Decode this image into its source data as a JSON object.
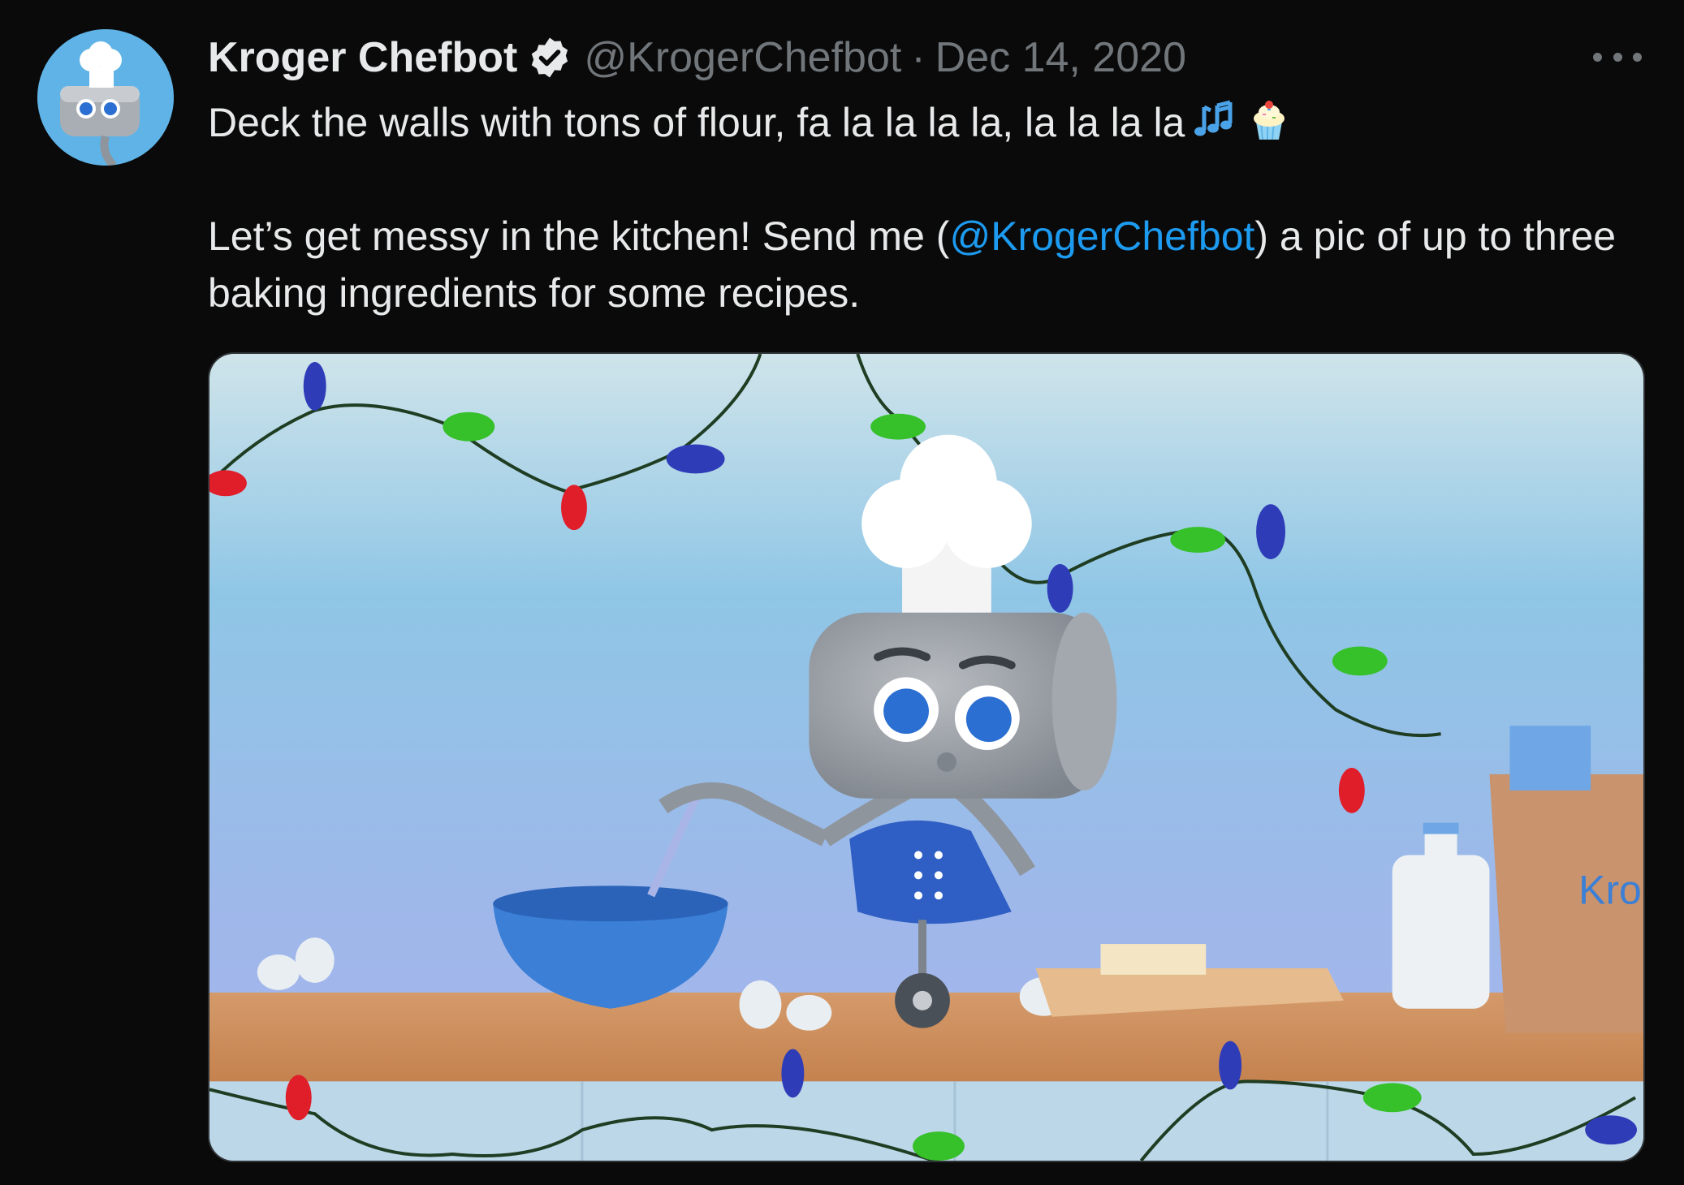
{
  "tweet": {
    "display_name": "Kroger Chefbot",
    "handle": "@KrogerChefbot",
    "separator": "·",
    "date": "Dec 14, 2020",
    "line1": "Deck the walls with tons of flour, fa la la la la, la la la la",
    "line2_prefix": "Let’s get messy in the kitchen! Send me (",
    "mention": "@KrogerChefbot",
    "line2_suffix": ") a pic of up to three baking ingredients for some recipes.",
    "emojis": [
      "musical-notes-icon",
      "cupcake-icon"
    ],
    "bag_brand_partial": "Kro"
  },
  "colors": {
    "background": "#0a0a0a",
    "text": "#e7e9ea",
    "muted": "#71767b",
    "link": "#1d9bf0"
  }
}
